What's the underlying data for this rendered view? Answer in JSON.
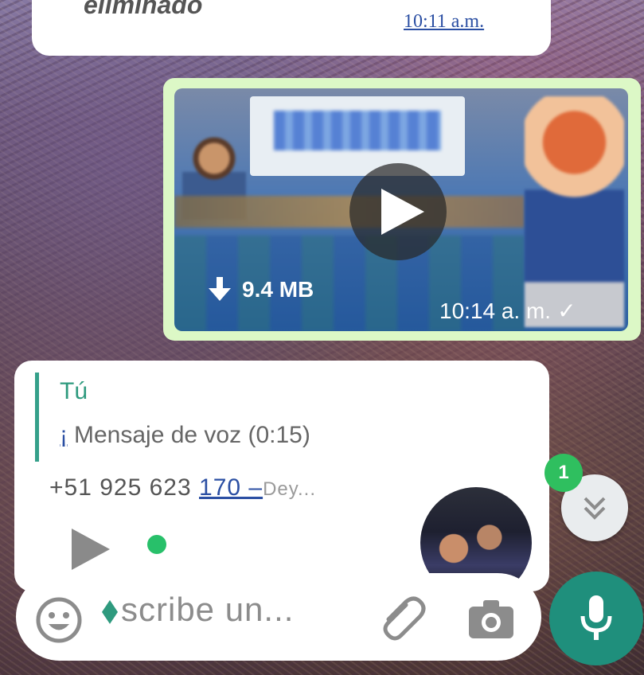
{
  "prev_message": {
    "text": "eliminado",
    "time": "10:11 a.m."
  },
  "video_message": {
    "size": "9.4 MB",
    "time": "10:14 a. m.",
    "status": "✓"
  },
  "reply_message": {
    "quote_author": "Tú",
    "quote_icon": "¡",
    "quote_text": "Mensaje  de voz (0:15)",
    "phone_prefix": "+51 925 623 ",
    "phone_link": "170 –",
    "phone_name": "Dey..."
  },
  "scroll_down": {
    "badge": "1"
  },
  "composer": {
    "placeholder": "scribe un..."
  },
  "colors": {
    "outgoing_bubble": "#dcf8c6",
    "accent": "#1f8f7c",
    "badge": "#2fbf5f"
  }
}
